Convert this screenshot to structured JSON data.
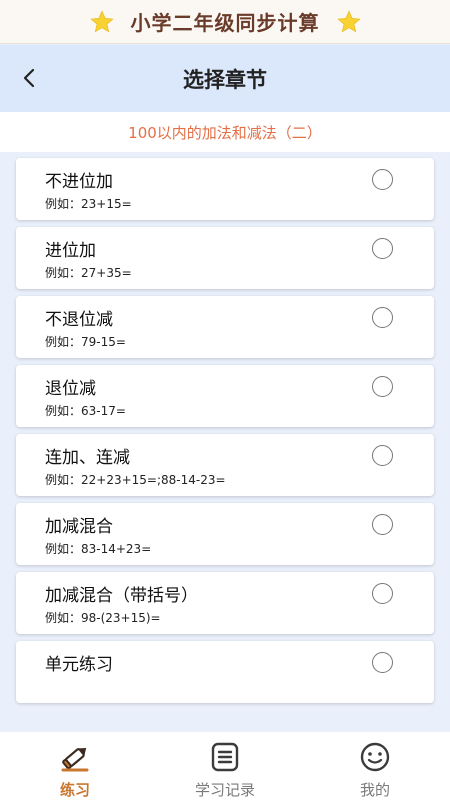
{
  "app": {
    "title": "小学二年级同步计算"
  },
  "navbar": {
    "title": "选择章节",
    "back_icon": "chevron-left-icon"
  },
  "chapter": {
    "title": "100以内的加法和减法（二）"
  },
  "items": [
    {
      "title": "不进位加",
      "example": "例如：23+15="
    },
    {
      "title": "进位加",
      "example": "例如：27+35="
    },
    {
      "title": "不退位减",
      "example": "例如：79-15="
    },
    {
      "title": "退位减",
      "example": "例如：63-17="
    },
    {
      "title": "连加、连减",
      "example": "例如：22+23+15=;88-14-23="
    },
    {
      "title": "加减混合",
      "example": "例如：83-14+23="
    },
    {
      "title": "加减混合（带括号）",
      "example": "例如：98-(23+15)="
    },
    {
      "title": "单元练习",
      "example": ""
    }
  ],
  "tabs": [
    {
      "label": "练习",
      "icon": "pencil-icon",
      "active": true
    },
    {
      "label": "学习记录",
      "icon": "list-icon",
      "active": false
    },
    {
      "label": "我的",
      "icon": "smiley-icon",
      "active": false
    }
  ],
  "colors": {
    "accent": "#e46f47",
    "tab_active": "#c9772f",
    "navbar_bg": "#dbe7fb",
    "page_bg": "#eaf0fb",
    "title_brown": "#6a3b2a",
    "star_yellow": "#f7d231"
  }
}
